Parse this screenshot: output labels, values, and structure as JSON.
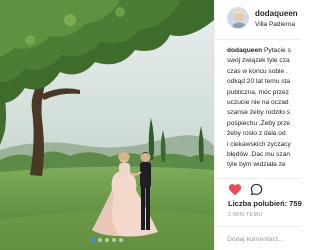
{
  "post": {
    "username": "dodaqueen",
    "location": "Villa Padierna",
    "caption_lines": [
      {
        "user": "dodaqueen",
        "text": " Pytacie s"
      },
      {
        "text": "swoj związek tyle cza"
      },
      {
        "text": "czas w koncu sobie ."
      },
      {
        "text": "odkąd 20 lat temu sta"
      },
      {
        "text": "publiczna, móc przez"
      },
      {
        "text": "uczucie nie na oczad"
      },
      {
        "text": "szanse żeby rodziło s"
      },
      {
        "text": "pośpiechu .Żeby prze"
      },
      {
        "text": "żeby rosło z dala od"
      },
      {
        "text": "i ciekawskich zyczacy"
      },
      {
        "text": "błędów .Dac mu szan"
      },
      {
        "text": "tyle bym widziała ze"
      }
    ],
    "likes_label": "Liczba polubień: 759",
    "timestamp": "2 MIN TEMU",
    "comment_placeholder": "Dodaj komentarz..."
  },
  "icons": {
    "like": "heart-icon",
    "comment": "comment-icon"
  },
  "colors": {
    "like_heart": "#ed4956",
    "carousel_active": "#3897f0",
    "secondary_text": "#999999"
  },
  "carousel": {
    "count": 5,
    "active_index": 0
  }
}
